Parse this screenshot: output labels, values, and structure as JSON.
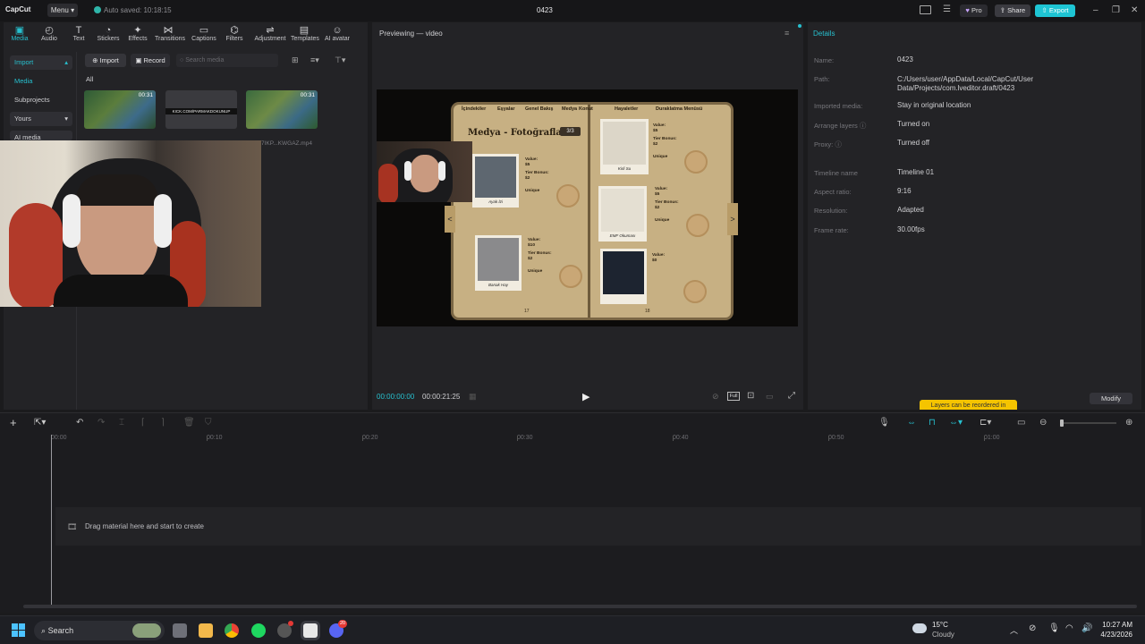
{
  "titlebar": {
    "logo": "CapCut",
    "menu_label": "Menu",
    "autosave_text": "Auto saved: 10:18:15",
    "project_title": "0423",
    "pro_label": "Pro",
    "share_label": "Share",
    "export_label": "Export"
  },
  "toolbar": {
    "items": [
      {
        "label": "Media",
        "icon": "media-icon"
      },
      {
        "label": "Audio",
        "icon": "audio-icon"
      },
      {
        "label": "Text",
        "icon": "text-icon"
      },
      {
        "label": "Stickers",
        "icon": "stickers-icon"
      },
      {
        "label": "Effects",
        "icon": "effects-icon"
      },
      {
        "label": "Transitions",
        "icon": "transitions-icon"
      },
      {
        "label": "Captions",
        "icon": "captions-icon"
      },
      {
        "label": "Filters",
        "icon": "filters-icon"
      },
      {
        "label": "Adjustment",
        "icon": "adjustment-icon"
      },
      {
        "label": "Templates",
        "icon": "templates-icon"
      },
      {
        "label": "AI avatar",
        "icon": "ai-avatar-icon"
      }
    ]
  },
  "media_panel": {
    "sidebar": [
      "Import",
      "Media",
      "Subprojects",
      "Yours",
      "AI media"
    ],
    "import_button": "Import",
    "record_button": "Record",
    "search_placeholder": "Search media",
    "filter_all": "All",
    "thumbs": [
      {
        "duration": "00:31",
        "caption": ""
      },
      {
        "duration": "",
        "caption": ""
      },
      {
        "duration": "00:31",
        "caption": "7IKP...KWGAZ.mp4"
      }
    ],
    "thumb_banner_text": "KICK.COM/PARMAKDOKUNUP"
  },
  "preview": {
    "title": "Previewing — video",
    "time_current": "00:00:00:00",
    "time_total": "00:00:21:25",
    "full_label": "Full",
    "game": {
      "tabs": [
        "Eşyalar",
        "Genel Bakış",
        "Medya",
        "Konut",
        "Hayaletler",
        "Duraklatma Menüsü"
      ],
      "first_tab": "İçindekiler",
      "page_title": "Medya - Fotoğraflar",
      "page_count": "3/3",
      "photos": [
        {
          "caption": "Ayak İzi",
          "value": "$5",
          "tier_bonus": "$2",
          "rarity": "Unique"
        },
        {
          "caption": "Kirli Su",
          "value": "$5",
          "tier_bonus": "$2",
          "rarity": "Unique"
        },
        {
          "caption": "EMF Okuması",
          "value": "$5",
          "tier_bonus": "$2",
          "rarity": "Unique"
        },
        {
          "caption": "Banak Hay",
          "value": "$10",
          "tier_bonus": "$2",
          "rarity": "Unique"
        },
        {
          "caption": "",
          "value": "$0",
          "tier_bonus": "",
          "rarity": ""
        }
      ],
      "value_label": "Value:",
      "tier_label": "Tier Bonus:",
      "page_numbers": [
        "17",
        "18"
      ]
    }
  },
  "details": {
    "header": "Details",
    "rows": [
      {
        "label": "Name:",
        "value": "0423"
      },
      {
        "label": "Path:",
        "value": "C:/Users/user/AppData/Local/CapCut/User Data/Projects/com.lveditor.draft/0423"
      },
      {
        "label": "Imported media:",
        "value": "Stay in original location"
      },
      {
        "label": "Arrange layers",
        "value": "Turned on"
      },
      {
        "label": "Proxy:",
        "value": "Turned off"
      },
      {
        "label": "Timeline name",
        "value": "Timeline 01"
      },
      {
        "label": "Aspect ratio:",
        "value": "9:16"
      },
      {
        "label": "Resolution:",
        "value": "Adapted"
      },
      {
        "label": "Frame rate:",
        "value": "30.00fps"
      }
    ],
    "tooltip": "Layers can be reordered in",
    "modify_button": "Modify"
  },
  "timeline": {
    "ruler": [
      "00:00",
      "00:10",
      "00:20",
      "00:30",
      "00:40",
      "00:50",
      "01:00"
    ],
    "empty_text": "Drag material here and start to create"
  },
  "taskbar": {
    "search_label": "Search",
    "weather_temp": "15°C",
    "weather_desc": "Cloudy",
    "time": "10:27 AM",
    "date": "4/23/2026",
    "discord_badge": "20"
  },
  "colors": {
    "accent": "#27c0cf",
    "export": "#1ec5d4",
    "tooltip": "#f5c400",
    "bg": "#1b1b1d",
    "panel": "#232326"
  }
}
